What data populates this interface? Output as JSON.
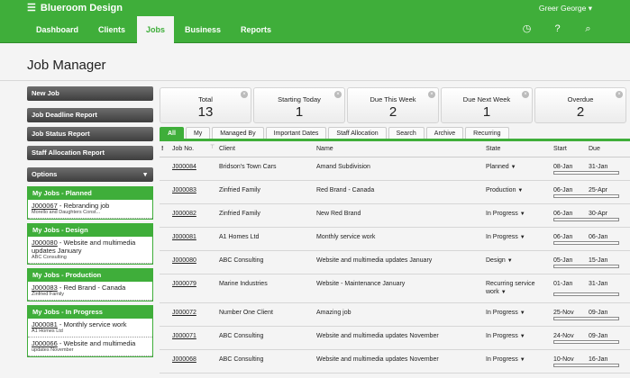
{
  "app": {
    "title": "Blueroom Design",
    "user": "Greer George"
  },
  "nav": {
    "items": [
      {
        "label": "Dashboard"
      },
      {
        "label": "Clients"
      },
      {
        "label": "Jobs"
      },
      {
        "label": "Business"
      },
      {
        "label": "Reports"
      }
    ]
  },
  "page": {
    "title": "Job Manager"
  },
  "sidebar": {
    "buttons": [
      "New Job",
      "Job Deadline Report",
      "Job Status Report",
      "Staff Allocation Report"
    ],
    "options": "Options",
    "panels": [
      {
        "title": "My Jobs - Planned",
        "items": [
          {
            "code": "J000067",
            "name": "Rebranding job",
            "client": "Morello and Daughters Const..."
          }
        ]
      },
      {
        "title": "My Jobs - Design",
        "items": [
          {
            "code": "J000080",
            "name": "Website and multimedia updates January",
            "client": "ABC Consulting"
          }
        ]
      },
      {
        "title": "My Jobs - Production",
        "items": [
          {
            "code": "J000083",
            "name": "Red Brand - Canada",
            "client": "Zinfried Family"
          }
        ]
      },
      {
        "title": "My Jobs - In Progress",
        "items": [
          {
            "code": "J000081",
            "name": "Monthly service work",
            "client": "A1 Homes Ltd"
          },
          {
            "code": "J000066",
            "name": "Website and multimedia",
            "client": "updates November"
          }
        ]
      }
    ]
  },
  "stats": [
    {
      "label": "Total",
      "value": "13"
    },
    {
      "label": "Starting Today",
      "value": "1"
    },
    {
      "label": "Due This Week",
      "value": "2"
    },
    {
      "label": "Due Next Week",
      "value": "1"
    },
    {
      "label": "Overdue",
      "value": "2"
    }
  ],
  "tabs": [
    "All",
    "My",
    "Managed By",
    "Important Dates",
    "Staff Allocation",
    "Search",
    "Archive",
    "Recurring"
  ],
  "table": {
    "headers": {
      "flag": "!",
      "job": "Job No.",
      "client": "Client",
      "name": "Name",
      "state": "State",
      "start": "Start",
      "due": "Due"
    },
    "rows": [
      {
        "job": "J000084",
        "client": "Bridson's Town Cars",
        "name": "Amand Subdivision",
        "state": "Planned",
        "start": "08-Jan",
        "due": "31-Jan"
      },
      {
        "job": "J000083",
        "client": "Zinfried Family",
        "name": "Red Brand - Canada",
        "state": "Production",
        "start": "06-Jan",
        "due": "25-Apr"
      },
      {
        "job": "J000082",
        "client": "Zinfried Family",
        "name": "New Red Brand",
        "state": "In Progress",
        "start": "06-Jan",
        "due": "30-Apr"
      },
      {
        "job": "J000081",
        "client": "A1 Homes Ltd",
        "name": "Monthly service work",
        "state": "In Progress",
        "start": "06-Jan",
        "due": "06-Jan"
      },
      {
        "job": "J000080",
        "client": "ABC Consulting",
        "name": "Website and multimedia updates January",
        "state": "Design",
        "start": "05-Jan",
        "due": "15-Jan"
      },
      {
        "job": "J000079",
        "client": "Marine Industries",
        "name": "Website - Maintenance January",
        "state": "Recurring service work",
        "start": "01-Jan",
        "due": "31-Jan"
      },
      {
        "job": "J000072",
        "client": "Number One Client",
        "name": "Amazing job",
        "state": "In Progress",
        "start": "25-Nov",
        "due": "09-Jan"
      },
      {
        "job": "J000071",
        "client": "ABC Consulting",
        "name": "Website and multimedia updates November",
        "state": "In Progress",
        "start": "24-Nov",
        "due": "09-Jan"
      },
      {
        "job": "J000068",
        "client": "ABC Consulting",
        "name": "Website and multimedia updates November",
        "state": "In Progress",
        "start": "10-Nov",
        "due": "16-Jan"
      }
    ]
  }
}
